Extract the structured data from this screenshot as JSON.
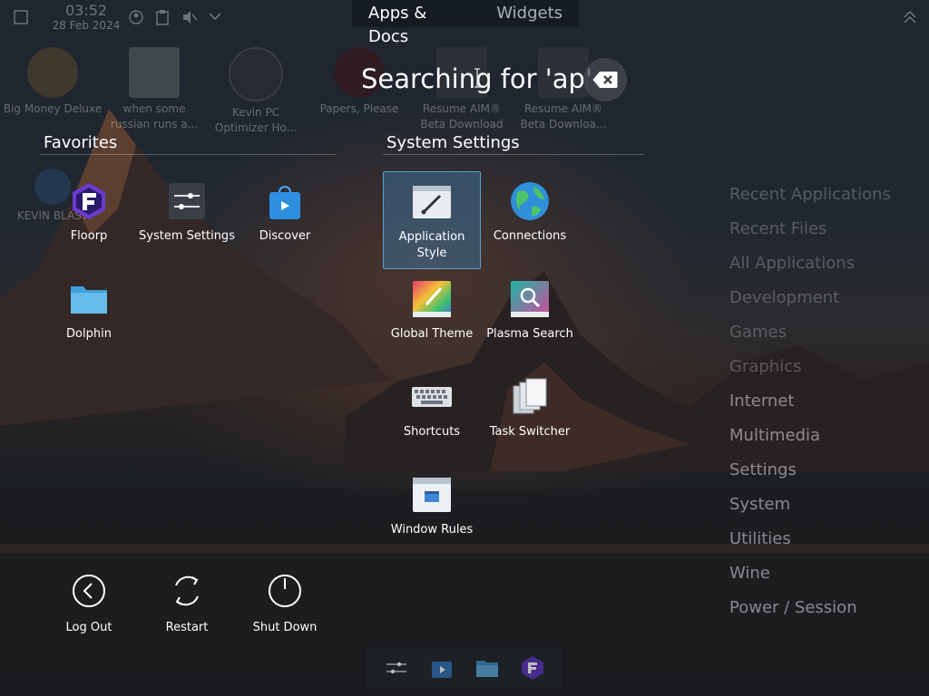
{
  "topbar": {
    "time": "03:52",
    "date": "28 Feb 2024",
    "tabs": [
      {
        "label": "Apps & Docs",
        "active": true
      },
      {
        "label": "Widgets",
        "active": false
      }
    ]
  },
  "desktop_icons": [
    {
      "label": "Big Money Deluxe",
      "icon": "dollar-bag-icon"
    },
    {
      "label": "when some russian runs a...",
      "icon": "video-icon"
    },
    {
      "label": "Kevin PC Optimizer Ho...",
      "icon": "gauge-icon"
    },
    {
      "label": "Papers, Please",
      "icon": "papers-icon"
    },
    {
      "label": "Resume AIM® Beta Download",
      "icon": "file-icon"
    },
    {
      "label": "Resume AIM® Beta Downloa...",
      "icon": "file-icon"
    },
    {
      "label": "KEVIN BLAST",
      "icon": "globe-icon"
    }
  ],
  "search": {
    "text": "Searching for 'ap'",
    "clear_icon": "backspace-icon"
  },
  "favorites": {
    "title": "Favorites",
    "items": [
      {
        "label": "Floorp",
        "icon": "floorp-icon"
      },
      {
        "label": "System Settings",
        "icon": "settings-sliders-icon"
      },
      {
        "label": "Discover",
        "icon": "shopping-bag-icon"
      },
      {
        "label": "Dolphin",
        "icon": "folder-icon"
      }
    ]
  },
  "system_settings": {
    "title": "System Settings",
    "items": [
      {
        "label": "Application Style",
        "icon": "brush-window-icon",
        "selected": true
      },
      {
        "label": "Connections",
        "icon": "globe-icon"
      },
      {
        "label": "Global Theme",
        "icon": "theme-palette-icon"
      },
      {
        "label": "Plasma Search",
        "icon": "magnifier-icon"
      },
      {
        "label": "Shortcuts",
        "icon": "keyboard-icon"
      },
      {
        "label": "Task Switcher",
        "icon": "stacked-windows-icon"
      },
      {
        "label": "Window Rules",
        "icon": "window-icon"
      }
    ]
  },
  "categories": [
    "Recent Applications",
    "Recent Files",
    "All Applications",
    "Development",
    "Games",
    "Graphics",
    "Internet",
    "Multimedia",
    "Settings",
    "System",
    "Utilities",
    "Wine",
    "Power / Session"
  ],
  "power": [
    {
      "label": "Log Out",
      "icon": "logout-icon"
    },
    {
      "label": "Restart",
      "icon": "restart-icon"
    },
    {
      "label": "Shut Down",
      "icon": "shutdown-icon"
    }
  ],
  "dock": [
    "settings-sliders-icon",
    "shopping-bag-icon",
    "folder-icon",
    "floorp-icon"
  ],
  "colors": {
    "selection_bg": "#3d6e96",
    "selection_border": "#5ea0cc",
    "category_text": "#dce0e6"
  }
}
